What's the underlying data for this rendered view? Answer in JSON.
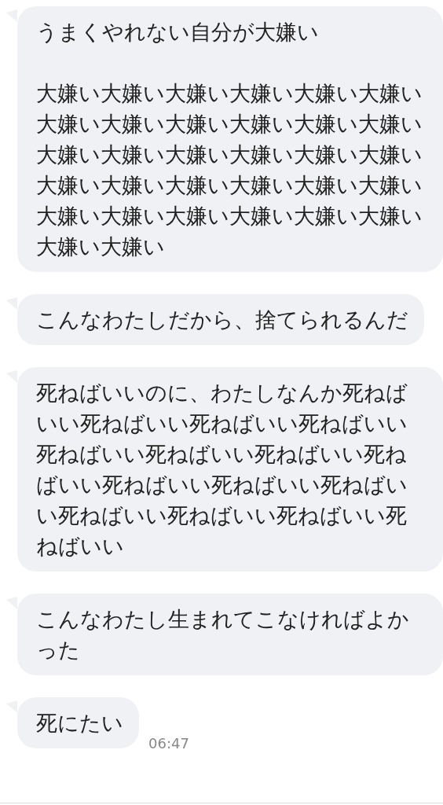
{
  "messages": [
    {
      "paragraphs": [
        "うまくやれない自分が大嫌い",
        "大嫌い大嫌い大嫌い大嫌い大嫌い大嫌い大嫌い大嫌い大嫌い大嫌い大嫌い大嫌い大嫌い大嫌い大嫌い大嫌い大嫌い大嫌い大嫌い大嫌い大嫌い大嫌い大嫌い大嫌い大嫌い大嫌い大嫌い大嫌い大嫌い大嫌い大嫌い大嫌い"
      ]
    },
    {
      "paragraphs": [
        "こんなわたしだから、捨てられるんだ"
      ]
    },
    {
      "paragraphs": [
        "死ねばいいのに、わたしなんか死ねばいい死ねばいい死ねばいい死ねばいい死ねばいい死ねばいい死ねばいい死ねばいい死ねばいい死ねばいい死ねばいい死ねばいい死ねばいい死ねばいい死ねばいい"
      ]
    },
    {
      "paragraphs": [
        "こんなわたし生まれてこなければよかった"
      ]
    },
    {
      "paragraphs": [
        "死にたい"
      ],
      "time": "06:47"
    }
  ]
}
